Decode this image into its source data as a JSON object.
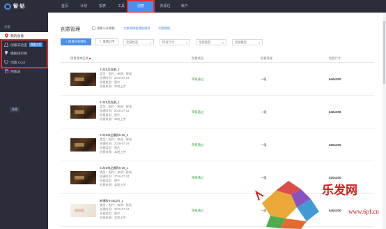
{
  "app": {
    "logo_text": "智·钻"
  },
  "topnav": {
    "items": [
      "首页",
      "计划",
      "报表",
      "工具",
      "创意",
      "资源位",
      "帐户"
    ],
    "active_index": 4
  },
  "sidebar": {
    "section_title": "创意",
    "items": [
      {
        "label": "我的创意",
        "icon": "location-pin-icon"
      },
      {
        "label": "创意实验室",
        "icon": "flask-icon",
        "badge": "智能工作"
      },
      {
        "label": "模板排行榜",
        "icon": "trophy-icon"
      },
      {
        "label": "创意 Cool",
        "icon": "diamond-icon"
      },
      {
        "label": "回收站",
        "icon": "trash-icon"
      }
    ],
    "collapse_label": "隐藏"
  },
  "content": {
    "title": "创意管理",
    "checkbox_label": "查看公开模板",
    "link_1": "大额高模板模板推荐",
    "link_2": "大额模板",
    "btn_primary": "创意已有制作",
    "btn_default": "本地上传",
    "filters": [
      "全部状态",
      "所有尺寸",
      "全部类型",
      "全部推型"
    ],
    "columns": [
      "创意基本信息",
      "创意状态",
      "创意等级",
      "创意尺寸"
    ],
    "rows": [
      {
        "name": "21年5月成果_2",
        "line1": "类型：图片；来源：智选",
        "line2": "创建时间：2016-07-24",
        "line3": "创意类型：图片",
        "line4": "创意来源：本地上传",
        "status": "审核通过",
        "level": "一级",
        "size": "640x200",
        "thumb": "dark"
      },
      {
        "name": "21年5月成果_1",
        "line1": "类型：图片；来源：智选",
        "line2": "创建时间：2016-07-24",
        "line3": "创意类型：图片",
        "line4": "创意来源：本地上传",
        "status": "审核通过",
        "level": "一级",
        "size": "640x200",
        "thumb": "dark"
      },
      {
        "name": "21年5单品爆款6-35_2",
        "line1": "类型：图片；来源：智选",
        "line2": "创建时间：2016-07-24",
        "line3": "创意类型：图片",
        "line4": "创意来源：本地上传",
        "status": "审核通过",
        "level": "一级",
        "size": "520x200",
        "thumb": "dark"
      },
      {
        "name": "21年5单品爆款6-35_1",
        "line1": "类型：图片；来源：智选",
        "line2": "创建时间：2016-07-24",
        "line3": "创意类型：图片",
        "line4": "创意来源：本地上传",
        "status": "审核通过",
        "level": "一级",
        "size": "520x200",
        "thumb": "dark"
      },
      {
        "name": "新爆款6-35口内_2",
        "line1": "类型：图片；来源：智选",
        "line2": "创建时间：2016-07-24",
        "line3": "创意类型：图片",
        "line4": "创意来源：本地上传",
        "status": "审核通过",
        "level": "一级",
        "size": "640x200",
        "thumb": "light"
      }
    ]
  },
  "watermark": {
    "brand": "乐发网",
    "url": "www.6pf.cn"
  },
  "colors": {
    "nav_bg": "#2b2d3b",
    "accent": "#4a8ef0",
    "highlight_red": "#e03030",
    "success": "#3aa43a"
  }
}
